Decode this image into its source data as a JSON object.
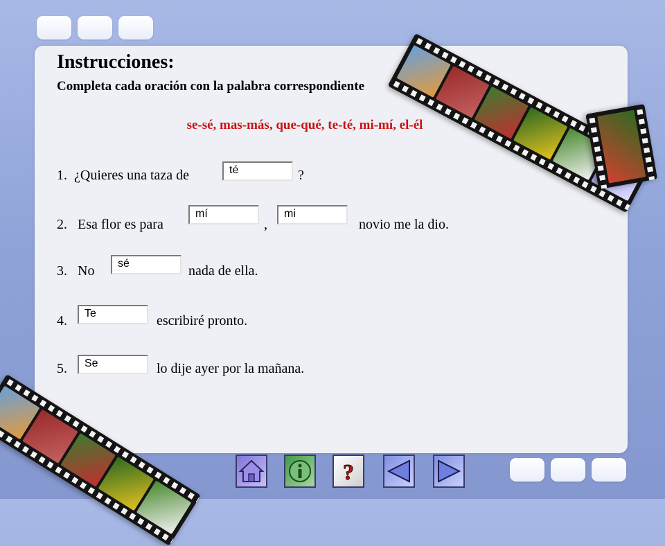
{
  "instructions": {
    "title": "Instrucciones:",
    "subtitle": "Completa cada oración con la palabra correspondiente",
    "word_pairs": "se-sé, mas-más, que-qué, te-té, mi-mí, el-él"
  },
  "exercises": [
    {
      "number": "1.",
      "before": "¿Quieres una taza de",
      "after": "?",
      "answers": [
        "té"
      ]
    },
    {
      "number": "2.",
      "before": "Esa flor es para",
      "middle": ",",
      "after": "novio me la dio.",
      "answers": [
        "mí",
        "mi"
      ]
    },
    {
      "number": "3.",
      "before": "No",
      "after": "nada de ella.",
      "answers": [
        "sé"
      ]
    },
    {
      "number": "4.",
      "after": "escribiré pronto.",
      "answers": [
        "Te"
      ]
    },
    {
      "number": "5.",
      "after": "lo dije ayer por la mañana.",
      "answers": [
        "Se"
      ]
    }
  ],
  "navigation": {
    "buttons": [
      "home-icon",
      "info-icon",
      "help-icon",
      "previous-icon",
      "next-icon"
    ]
  },
  "colors": {
    "word_pairs": "#cc1111",
    "background": "#8fa3d8",
    "panel": "#eef0f5"
  }
}
